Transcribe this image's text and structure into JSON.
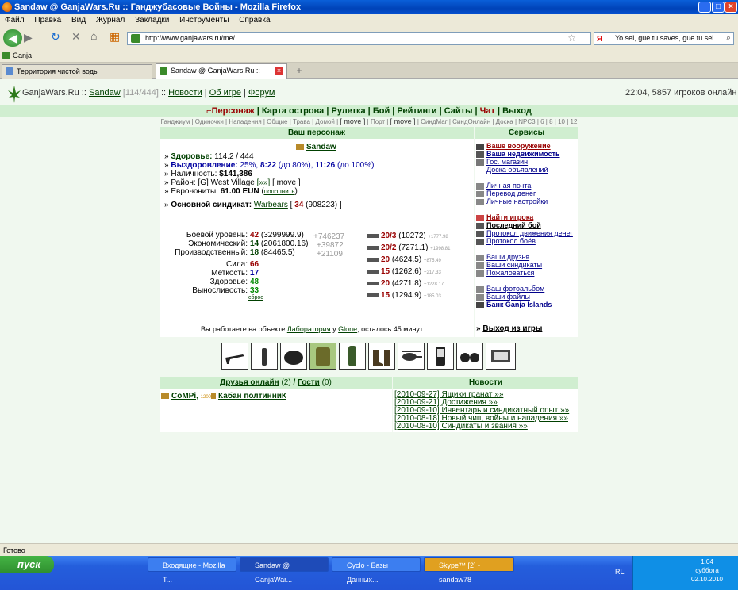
{
  "window": {
    "title": "Sandaw @ GanjaWars.Ru :: Ганджубасовые Войны - Mozilla Firefox"
  },
  "menu": [
    "Файл",
    "Правка",
    "Вид",
    "Журнал",
    "Закладки",
    "Инструменты",
    "Справка"
  ],
  "nav": {
    "url": "http://www.ganjawars.ru/me/",
    "search": "Yo sei, gue tu saves, gue tu sei"
  },
  "bookmarks": [
    "Ganja"
  ],
  "tabs": [
    {
      "label": "Территория чистой воды"
    },
    {
      "label": "Sandaw @ GanjaWars.Ru :: Гандж..."
    }
  ],
  "header": {
    "site": "GanjaWars.Ru",
    "sep": "::",
    "user": "Sandaw",
    "hp": "[114/444]",
    "links": [
      "Новости",
      "Об игре",
      "Форум"
    ],
    "online": "22:04, 5857 игроков онлайн"
  },
  "mainnav": {
    "items": [
      "Персонаж",
      "Карта острова",
      "Рулетка",
      "Бой",
      "Рейтинги",
      "Сайты",
      "Чат",
      "Выход"
    ]
  },
  "subnav": {
    "text1": "Ганджиум | Одиночки | Нападения | Общие | Трава | Домой |",
    "move1": "[ move ]",
    "text2": "| Порт |",
    "move2": "[ move ]",
    "text3": "| СиндМаг | СиндОнлайн | Доска | NPC3 | 6 | 8 | 10 | 12"
  },
  "character": {
    "heading": "Ваш персонаж",
    "name": "Sandaw",
    "health_label": "Здоровье:",
    "health_value": "114.2 / 444",
    "recovery_label": "Выздоровление:",
    "recovery_pct": "25%,",
    "recovery_t1": "8:22",
    "recovery_t1_note": "(до 80%),",
    "recovery_t2": "11:26",
    "recovery_t2_note": "(до 100%)",
    "cash_label": "Наличность:",
    "cash_value": "$141,386",
    "district_label": "Район:",
    "district_value": "[G] West Village",
    "district_link": "[»»]",
    "district_move": "[ move ]",
    "eun_label": "Евро-юниты:",
    "eun_value": "61.00 EUN",
    "eun_link": "пополнить",
    "synd_label": "Основной синдикат:",
    "synd_name": "Warbears",
    "synd_num": "34",
    "synd_pts": "(908223) ]",
    "levels": [
      {
        "label": "Боевой уровень:",
        "lvl": "42",
        "pts": "(3299999.9)",
        "gain": "+746237"
      },
      {
        "label": "Экономический:",
        "lvl": "14",
        "pts": "(2061800.16)",
        "gain": "+39872"
      },
      {
        "label": "Производственный:",
        "lvl": "18",
        "pts": "(84465.5)",
        "gain": "+21109"
      }
    ],
    "stats": [
      {
        "label": "Сила:",
        "val": "66"
      },
      {
        "label": "Меткость:",
        "val": "17"
      },
      {
        "label": "Здоровье:",
        "val": "48"
      },
      {
        "label": "Выносливость:",
        "val": "33"
      }
    ],
    "reset": "сброс",
    "weapons": [
      {
        "lvl": "20/3",
        "pts": "(10272)",
        "gain": "+1777.98"
      },
      {
        "lvl": "20/2",
        "pts": "(7271.1)",
        "gain": "+1998.81"
      },
      {
        "lvl": "20",
        "pts": "(4624.5)",
        "gain": "+875.49"
      },
      {
        "lvl": "15",
        "pts": "(1262.6)",
        "gain": "+217.33"
      },
      {
        "lvl": "20",
        "pts": "(4271.8)",
        "gain": "+1228.17"
      },
      {
        "lvl": "15",
        "pts": "(1294.9)",
        "gain": "+185.03"
      }
    ],
    "work_pre": "Вы работаете на объекте",
    "work_obj": "Лаборатория",
    "work_mid": "у",
    "work_owner": "Glone",
    "work_post": ", осталось 45 минут."
  },
  "services": {
    "heading": "Сервисы",
    "groups": [
      [
        "Ваше вооружение",
        "Ваша недвижимость",
        "Гос. магазин",
        "Доска объявлений"
      ],
      [
        "Личная почта",
        "Перевод денег",
        "Личные настройки"
      ],
      [
        "Найти игрока",
        "Последний бой",
        "Протокол движения денег",
        "Протокол боёв"
      ],
      [
        "Ваши друзья",
        "Ваши синдикаты",
        "Пожаловаться"
      ],
      [
        "Ваш фотоальбом",
        "Ваши файлы",
        "Банк Ganja Islands"
      ]
    ],
    "exit": "Выход из игры"
  },
  "friends": {
    "heading_a": "Друзья онлайн",
    "count_a": "(2)",
    "slash": "/",
    "heading_b": "Гости",
    "count_b": "(0)",
    "list": [
      "CoMPi,",
      "Кабан полтинниК"
    ],
    "badge": "1200"
  },
  "news": {
    "heading": "Новости",
    "items": [
      "[2010-09-27] Ящики гранат »»",
      "[2010-09-21] Достижения »»",
      "[2010-09-10] Инвентарь и синдикатный опыт »»",
      "[2010-08-18] Новый чип, войны и нападения »»",
      "[2010-08-10] Синдикаты и звания »»"
    ]
  },
  "status": "Готово",
  "taskbar": {
    "start": "пуск",
    "tasks": [
      "Входящие - Mozilla T...",
      "Sandaw @ GanjaWar...",
      "Cyclo - Базы Данных...",
      "Skype™ [2] - sandaw78"
    ],
    "lang": "RL",
    "time": "1:04",
    "day": "суббота",
    "date": "02.10.2010"
  },
  "colors": {
    "accent": "#004000",
    "header_bg": "#d0eed0",
    "page_bg": "#f0f8ef"
  }
}
